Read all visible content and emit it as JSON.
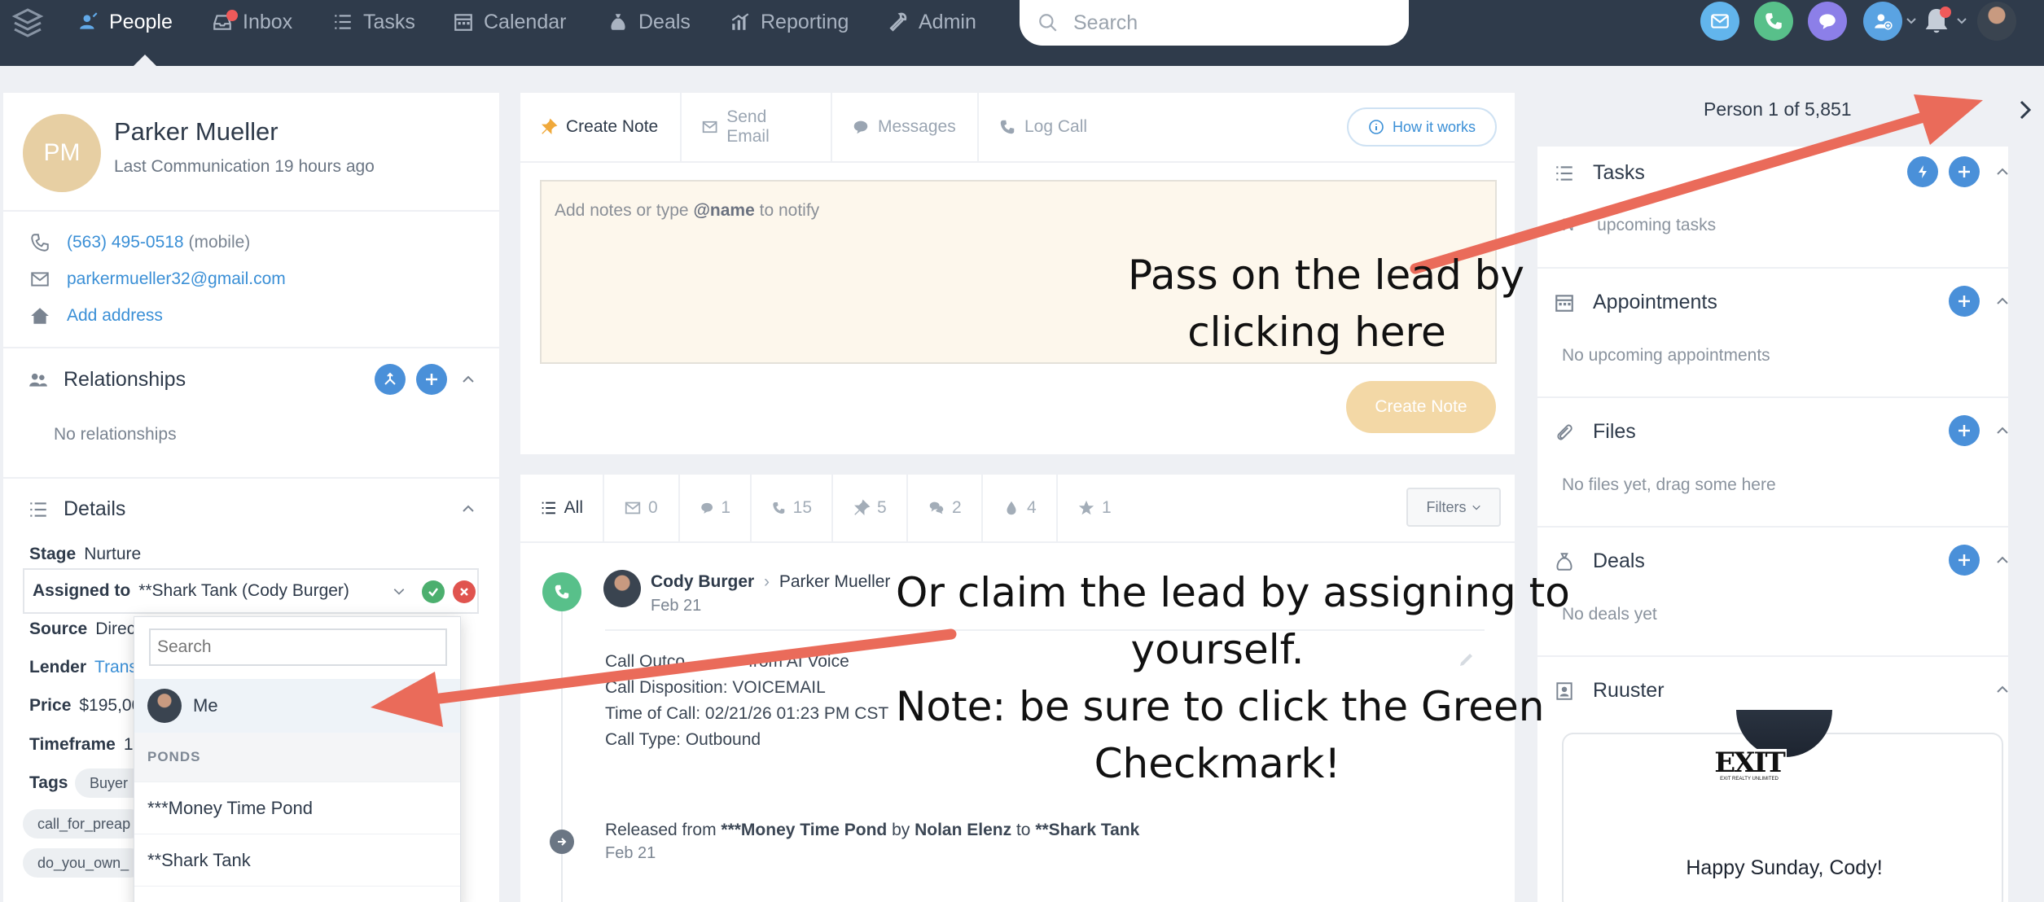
{
  "nav": {
    "items": [
      {
        "label": "People",
        "icon": "person-icon",
        "active": true
      },
      {
        "label": "Inbox",
        "icon": "inbox-icon",
        "active": false
      },
      {
        "label": "Tasks",
        "icon": "list-icon",
        "active": false
      },
      {
        "label": "Calendar",
        "icon": "calendar-icon",
        "active": false
      },
      {
        "label": "Deals",
        "icon": "money-bag-icon",
        "active": false
      },
      {
        "label": "Reporting",
        "icon": "chart-icon",
        "active": false
      },
      {
        "label": "Admin",
        "icon": "wrench-icon",
        "active": false
      }
    ],
    "search_placeholder": "Search"
  },
  "person": {
    "initials": "PM",
    "name": "Parker Mueller",
    "last_communication": "Last Communication 19 hours ago",
    "phone": "(563) 495-0518",
    "phone_type": "(mobile)",
    "email": "parkermueller32@gmail.com",
    "add_address": "Add address"
  },
  "relationships": {
    "title": "Relationships",
    "empty": "No relationships"
  },
  "details": {
    "title": "Details",
    "stage_label": "Stage",
    "stage_value": "Nurture",
    "assigned_label": "Assigned to",
    "assigned_value": "**Shark Tank (Cody Burger)",
    "source_label": "Source",
    "source_value": "Direc",
    "lender_label": "Lender",
    "lender_value": "Trans",
    "price_label": "Price",
    "price_value": "$195,00",
    "timeframe_label": "Timeframe",
    "timeframe_value": "1",
    "tags_label": "Tags",
    "tags": [
      "Buyer",
      "call_for_preap",
      "do_you_own_"
    ]
  },
  "assign_dropdown": {
    "search_placeholder": "Search",
    "me_label": "Me",
    "group_label": "PONDS",
    "items": [
      "***Money Time Pond",
      "**Shark Tank"
    ]
  },
  "composer": {
    "tabs": [
      "Create Note",
      "Send Email",
      "Messages",
      "Log Call"
    ],
    "how_it_works": "How it works",
    "placeholder_prefix": "Add notes or type ",
    "placeholder_bold": "@name",
    "placeholder_suffix": " to notify",
    "create_button": "Create Note"
  },
  "feed": {
    "filter_tabs": [
      {
        "label": "All",
        "icon": "list-icon"
      },
      {
        "label": "0",
        "icon": "email-icon"
      },
      {
        "label": "1",
        "icon": "message-icon"
      },
      {
        "label": "15",
        "icon": "phone-icon"
      },
      {
        "label": "5",
        "icon": "pin-icon"
      },
      {
        "label": "2",
        "icon": "chat-icon"
      },
      {
        "label": "4",
        "icon": "drop-icon"
      },
      {
        "label": "1",
        "icon": "star-icon"
      }
    ],
    "filters_button": "Filters",
    "call": {
      "from": "Cody Burger",
      "to": "Parker Mueller",
      "date": "Feb 21",
      "lines": [
        "Call Outco",
        "from AI Voice",
        "Call Disposition: VOICEMAIL",
        "Time of Call: 02/21/26 01:23 PM CST",
        "Call Type: Outbound"
      ]
    },
    "release": {
      "prefix": "Released from ",
      "pond": "***Money Time Pond",
      "by": " by ",
      "agent": "Nolan Elenz",
      "to": " to ",
      "target": "**Shark Tank",
      "date": "Feb 21"
    }
  },
  "sidebar": {
    "person_count": "Person 1 of 5,851",
    "sections": [
      {
        "title": "Tasks",
        "empty": "No upcoming tasks",
        "empty_visible": "upcoming tasks",
        "empty_lead": "N"
      },
      {
        "title": "Appointments",
        "empty": "No upcoming appointments"
      },
      {
        "title": "Files",
        "empty": "No files yet, drag some here"
      },
      {
        "title": "Deals",
        "empty": "No deals yet"
      },
      {
        "title": "Ruuster",
        "empty": ""
      }
    ],
    "ruuster_logo_text": "EXIT",
    "ruuster_logo_sub": "EXIT REALTY UNLIMITED",
    "ruuster_greeting": "Happy Sunday, Cody!"
  },
  "annotations": {
    "top_line1": "Pass on the lead by",
    "top_line2": "clicking here",
    "bottom_line1": "Or claim the lead by assigning to",
    "bottom_line2": "yourself.",
    "bottom_line3": "Note: be sure to click the Green",
    "bottom_line4": "Checkmark!"
  },
  "colors": {
    "nav_bg": "#2f3b4b",
    "accent_blue": "#4a90d9",
    "check_green": "#4caf6e",
    "cancel_red": "#e0544f",
    "arrow_red": "#ea6b5a"
  }
}
